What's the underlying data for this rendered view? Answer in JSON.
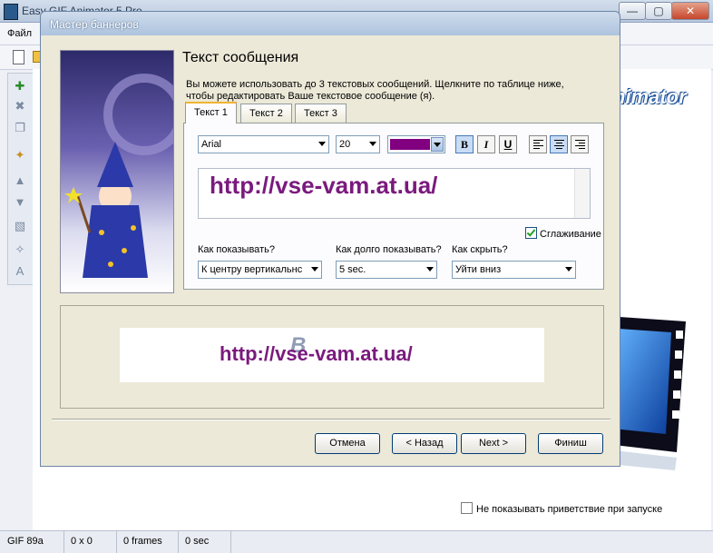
{
  "app": {
    "title": "Easy GIF Animator 5 Pro",
    "menu_file": "Файл",
    "brand_fragment": "nimator",
    "dont_show_label": "Не показывать приветствие при запуске",
    "statusbar": [
      "GIF 89a",
      "0 x 0",
      "0 frames",
      "0 sec"
    ],
    "window_buttons": {
      "minimize": "—",
      "maximize": "▢",
      "close": "✕"
    }
  },
  "dialog": {
    "title": "Мастер баннеров",
    "heading": "Текст сообщения",
    "description": "Вы можете использовать до 3 текстовых сообщений. Щелкните по таблице ниже, чтобы редактировать Ваше текстовое сообщение (я).",
    "tabs": [
      {
        "label": "Текст 1",
        "active": true
      },
      {
        "label": "Текст 2",
        "active": false
      },
      {
        "label": "Текст 3",
        "active": false
      }
    ],
    "font_name": "Arial",
    "font_size": "20",
    "text_color": "#800080",
    "format_buttons": {
      "bold": "B",
      "italic": "I",
      "underline": "U"
    },
    "message": "http://vse-vam.at.ua/",
    "smoothing_label": "Сглаживание",
    "show_label": "Как показывать?",
    "show_value": "К центру вертикальнс",
    "duration_label": "Как долго показывать?",
    "duration_value": "5 sec.",
    "hide_label": "Как скрыть?",
    "hide_value": "Уйти вниз",
    "preview_text": "http://vse-vam.at.ua/",
    "buttons": {
      "cancel": "Отмена",
      "back": "< Назад",
      "next": "Next >",
      "finish": "Финиш"
    }
  }
}
